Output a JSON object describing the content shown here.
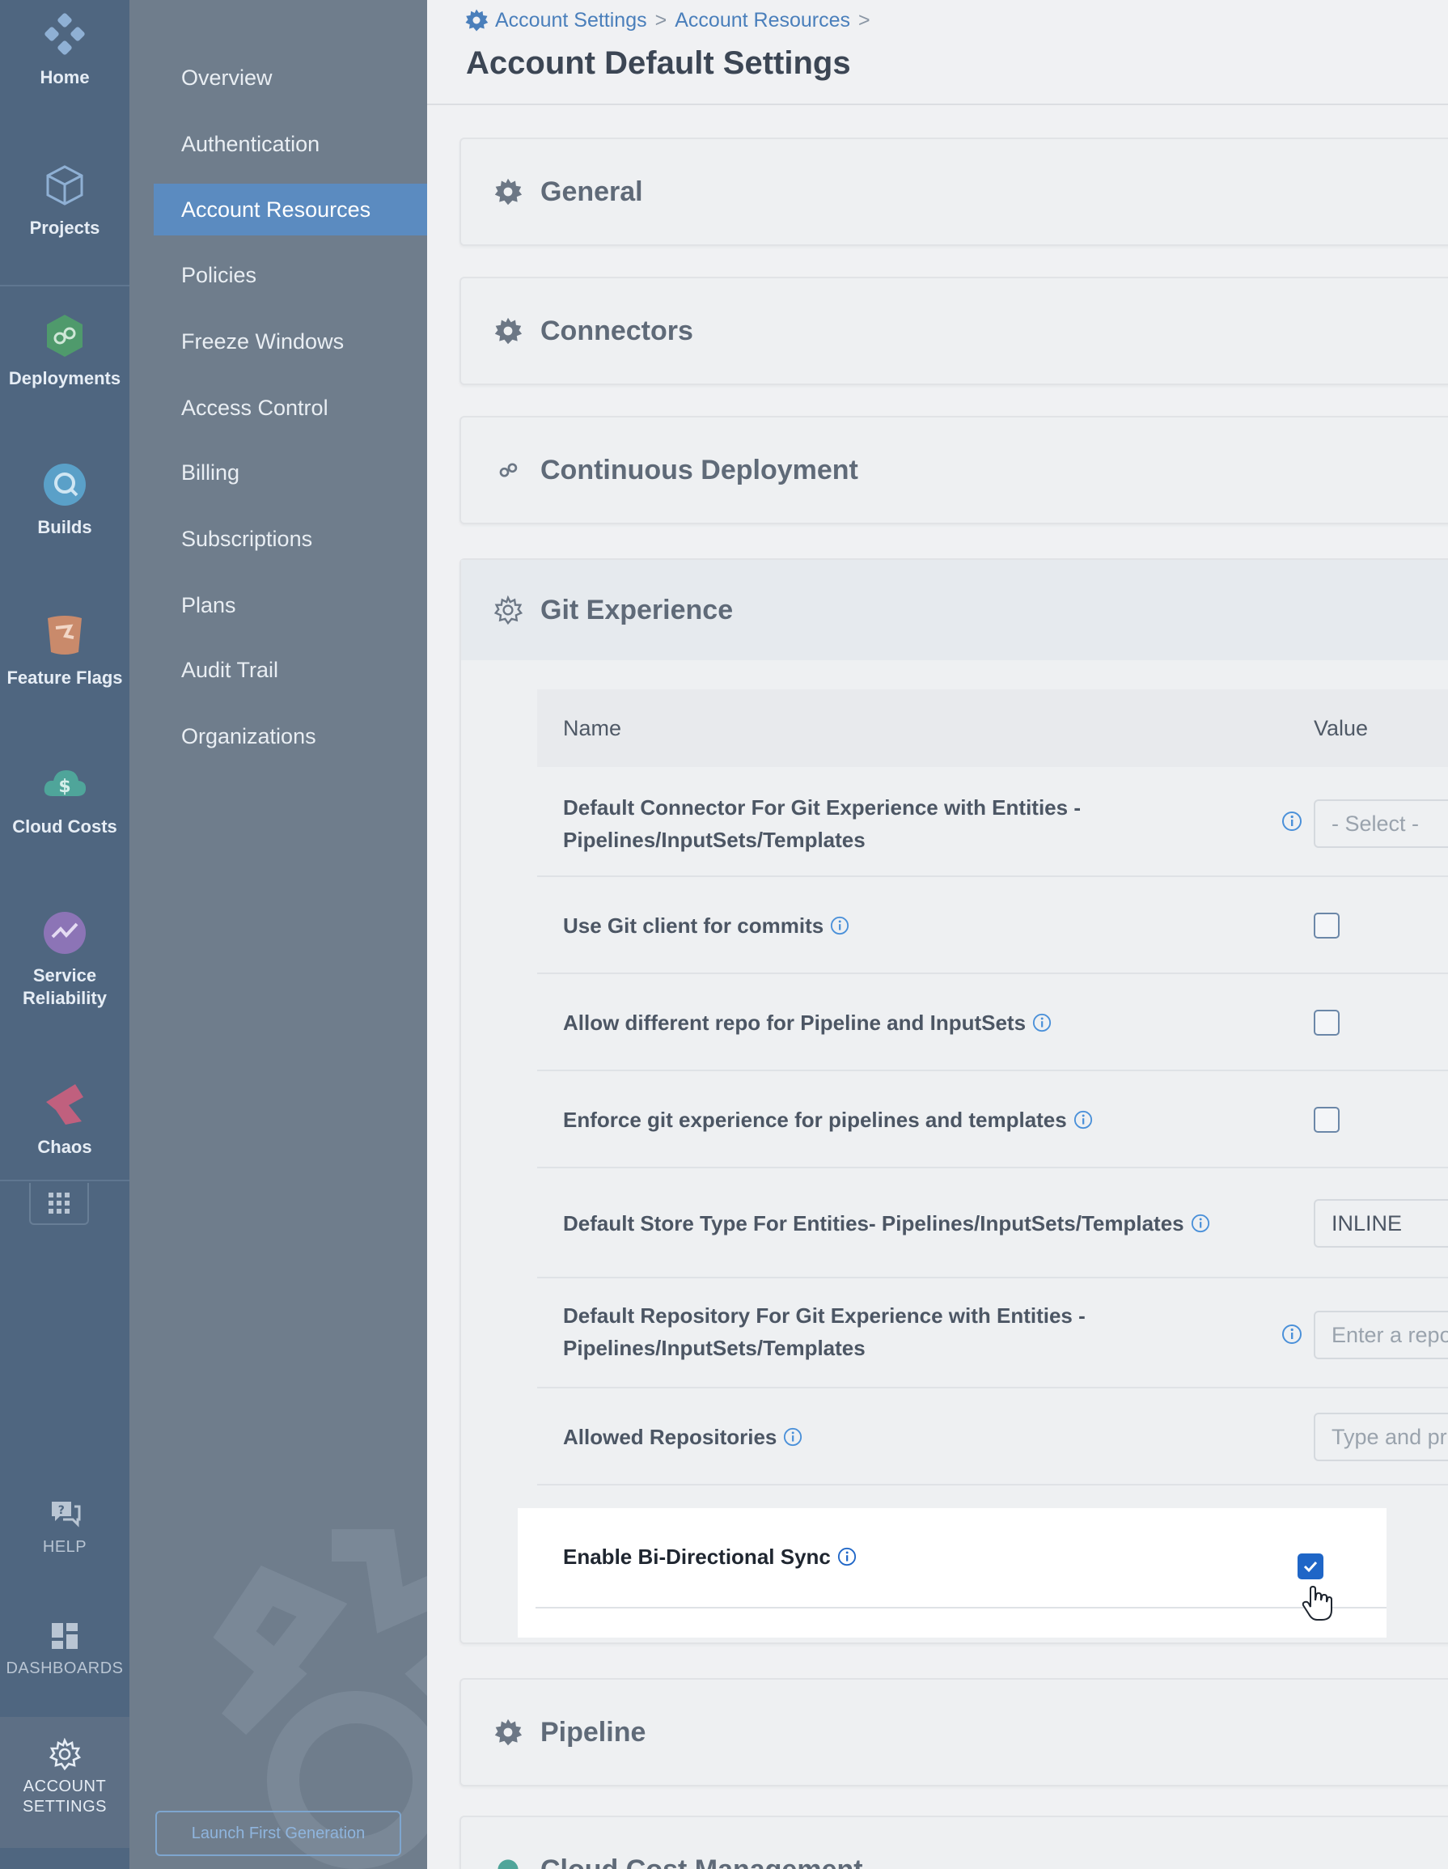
{
  "leftnav": {
    "items": [
      {
        "label": "Home",
        "icon": "home-icon"
      },
      {
        "label": "Projects",
        "icon": "projects-icon"
      },
      {
        "label": "Deployments",
        "icon": "deployments-icon"
      },
      {
        "label": "Builds",
        "icon": "builds-icon"
      },
      {
        "label": "Feature Flags",
        "icon": "feature-flags-icon"
      },
      {
        "label": "Cloud Costs",
        "icon": "cloud-costs-icon"
      },
      {
        "label": "Service Reliability",
        "icon": "service-reliability-icon"
      },
      {
        "label": "Chaos",
        "icon": "chaos-icon"
      }
    ],
    "help": "HELP",
    "dashboards": "DASHBOARDS",
    "account_settings_line1": "ACCOUNT",
    "account_settings_line2": "SETTINGS"
  },
  "subnav": {
    "items": [
      "Overview",
      "Authentication",
      "Account Resources",
      "Policies",
      "Freeze Windows",
      "Access Control",
      "Billing",
      "Subscriptions",
      "Plans",
      "Audit Trail",
      "Organizations"
    ],
    "active": "Account Resources",
    "launch_button": "Launch First Generation"
  },
  "header": {
    "breadcrumb": [
      "Account Settings",
      "Account Resources"
    ],
    "title": "Account Default Settings"
  },
  "sections": {
    "general": "General",
    "connectors": "Connectors",
    "continuous_deployment": "Continuous Deployment",
    "git_experience": "Git Experience",
    "pipeline": "Pipeline",
    "cloud_cost": "Cloud Cost Management"
  },
  "table": {
    "col_name": "Name",
    "col_value": "Value",
    "rows": {
      "default_connector_line1": "Default Connector For Git Experience with Entities -",
      "default_connector_line2": "Pipelines/InputSets/Templates",
      "default_connector_value": "- Select -",
      "use_git_client": "Use Git client for commits",
      "allow_different_repo": "Allow different repo for Pipeline and InputSets",
      "enforce_git": "Enforce git experience for pipelines and templates",
      "default_store_type": "Default Store Type For Entities- Pipelines/InputSets/Templates",
      "default_store_type_value": "INLINE",
      "default_repo_line1": "Default Repository For Git Experience with Entities -",
      "default_repo_line2": "Pipelines/InputSets/Templates",
      "default_repo_placeholder": "Enter a repo",
      "allowed_repos": "Allowed Repositories",
      "allowed_repos_placeholder": "Type and pr",
      "bi_directional_sync": "Enable Bi-Directional Sync"
    }
  },
  "colors": {
    "nav_bg": "#4f6680",
    "subnav_bg": "#6f7d8c",
    "active_item": "#5b8bc0",
    "link": "#4a7fbb",
    "checkbox_checked": "#1f66c7"
  }
}
